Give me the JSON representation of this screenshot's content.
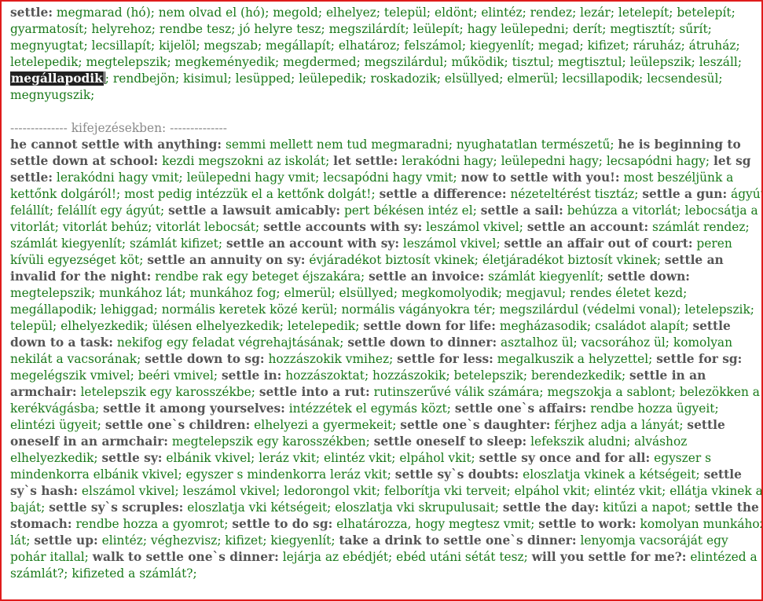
{
  "colors": {
    "border": "#e01b1b",
    "headword": "#555555",
    "translation": "#1a7a1a",
    "highlight_bg": "#222222",
    "divider": "#8a8a8a"
  },
  "main_entry": {
    "head": "settle:",
    "meanings_before": "megmarad (hó); nem olvad el (hó); megold; elhelyez; települ; eldönt; elintéz; rendez; lezár; letelepít; betelepít; gyarmatosít; helyrehoz; rendbe tesz; jó helyre tesz; megszilárdít; leülepít; hagy leülepedni; derít; megtisztít; sűrít; megnyugtat; lecsillapít; kijelöl; megszab; megállapít; elhatároz; felszámol; kiegyenlít; megad; kifizet; ráruház; átruház; letelepedik; megtelepszik; megkeményedik; megdermed; megszilárdul; működik; tisztul; megtisztul; leülepszik; leszáll;",
    "highlighted": "megállapodik",
    "meanings_after": "; rendbejön; kisimul; lesüpped; leülepedik; roskadozik; elsüllyed; elmerül; lecsillapodik; lecsendesül; megnyugszik;"
  },
  "divider_text": "-------------- kifejezésekben: --------------",
  "phrases": [
    {
      "h": "he cannot settle with anything:",
      "t": "semmi mellett nem tud megmaradni; nyughatatlan természetű;"
    },
    {
      "h": "he is beginning to settle down at school:",
      "t": "kezdi megszokni az iskolát;"
    },
    {
      "h": "let settle:",
      "t": "lerakódni hagy; leülepedni hagy; lecsapódni hagy;"
    },
    {
      "h": "let sg settle:",
      "t": "lerakódni hagy vmit; leülepedni hagy vmit; lecsapódni hagy vmit;"
    },
    {
      "h": "now to settle with you!:",
      "t": "most beszéljünk a kettőnk dolgáról!; most pedig intézzük el a kettőnk dolgát!;"
    },
    {
      "h": "settle a difference:",
      "t": "nézeteltérést tisztáz;"
    },
    {
      "h": "settle a gun:",
      "t": "ágyút felállít; felállít egy ágyút;"
    },
    {
      "h": "settle a lawsuit amicably:",
      "t": "pert békésen intéz el;"
    },
    {
      "h": "settle a sail:",
      "t": "behúzza a vitorlát; lebocsátja a vitorlát; vitorlát behúz; vitorlát lebocsát;"
    },
    {
      "h": "settle accounts with sy:",
      "t": "leszámol vkivel;"
    },
    {
      "h": "settle an account:",
      "t": "számlát rendez; számlát kiegyenlít; számlát kifizet;"
    },
    {
      "h": "settle an account with sy:",
      "t": "leszámol vkivel;"
    },
    {
      "h": "settle an affair out of court:",
      "t": "peren kívüli egyezséget köt;"
    },
    {
      "h": "settle an annuity on sy:",
      "t": "évjáradékot biztosít vkinek; életjáradékot biztosít vkinek;"
    },
    {
      "h": "settle an invalid for the night:",
      "t": "rendbe rak egy beteget éjszakára;"
    },
    {
      "h": "settle an invoice:",
      "t": "számlát kiegyenlít;"
    },
    {
      "h": "settle down:",
      "t": "megtelepszik; munkához lát; munkához fog; elmerül; elsüllyed; megkomolyodik; megjavul; rendes életet kezd; megállapodik; lehiggad; normális keretek közé kerül; normális vágányokra tér; megszilárdul (védelmi vonal); letelepszik; települ; elhelyezkedik; ülésen elhelyezkedik; letelepedik;"
    },
    {
      "h": "settle down for life:",
      "t": "megházasodik; családot alapít;"
    },
    {
      "h": "settle down to a task:",
      "t": "nekifog egy feladat végrehajtásának;"
    },
    {
      "h": "settle down to dinner:",
      "t": "asztalhoz ül; vacsorához ül; komolyan nekilát a vacsorának;"
    },
    {
      "h": "settle down to sg:",
      "t": "hozzászokik vmihez;"
    },
    {
      "h": "settle for less:",
      "t": "megalkuszik a helyzettel;"
    },
    {
      "h": "settle for sg:",
      "t": "megelégszik vmivel; beéri vmivel;"
    },
    {
      "h": "settle in:",
      "t": "hozzászoktat; hozzászokik; betelepszik; berendezkedik;"
    },
    {
      "h": "settle in an armchair:",
      "t": "letelepszik egy karosszékbe;"
    },
    {
      "h": "settle into a rut:",
      "t": "rutinszerűvé válik számára; megszokja a sablont; belezökken a kerékvágásba;"
    },
    {
      "h": "settle it among yourselves:",
      "t": "intézzétek el egymás közt;"
    },
    {
      "h": "settle one`s affairs:",
      "t": "rendbe hozza ügyeit; elintézi ügyeit;"
    },
    {
      "h": "settle one`s children:",
      "t": "elhelyezi a gyermekeit;"
    },
    {
      "h": "settle one`s daughter:",
      "t": "férjhez adja a lányát;"
    },
    {
      "h": "settle oneself in an armchair:",
      "t": "megtelepszik egy karosszékben;"
    },
    {
      "h": "settle oneself to sleep:",
      "t": "lefekszik aludni; alváshoz elhelyezkedik;"
    },
    {
      "h": "settle sy:",
      "t": "elbánik vkivel; leráz vkit; elintéz vkit; elpáhol vkit;"
    },
    {
      "h": "settle sy once and for all:",
      "t": "egyszer s mindenkorra elbánik vkivel; egyszer s mindenkorra leráz vkit;"
    },
    {
      "h": "settle sy`s doubts:",
      "t": "eloszlatja vkinek a kétségeit;"
    },
    {
      "h": "settle sy`s hash:",
      "t": "elszámol vkivel; leszámol vkivel; ledorongol vkit; felborítja vki terveit; elpáhol vkit; elintéz vkit; ellátja vkinek a baját;"
    },
    {
      "h": "settle sy`s scruples:",
      "t": "eloszlatja vki kétségeit; eloszlatja vki skrupulusait;"
    },
    {
      "h": "settle the day:",
      "t": "kitűzi a napot;"
    },
    {
      "h": "settle the stomach:",
      "t": "rendbe hozza a gyomrot;"
    },
    {
      "h": "settle to do sg:",
      "t": "elhatározza, hogy megtesz vmit;"
    },
    {
      "h": "settle to work:",
      "t": "komolyan munkához lát;"
    },
    {
      "h": "settle up:",
      "t": "elintéz; véghezvisz; kifizet; kiegyenlít;"
    },
    {
      "h": "take a drink to settle one`s dinner:",
      "t": "lenyomja vacsoráját egy pohár itallal;"
    },
    {
      "h": "walk to settle one`s dinner:",
      "t": "lejárja az ebédjét; ebéd utáni sétát tesz;"
    },
    {
      "h": "will you settle for me?:",
      "t": "elintézed a számlát?; kifizeted a számlát?;"
    }
  ]
}
